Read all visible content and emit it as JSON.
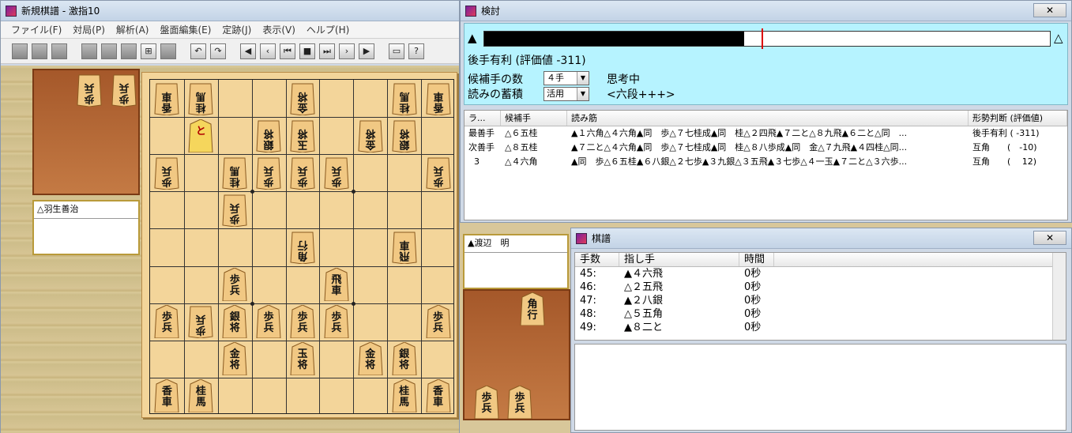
{
  "main_window": {
    "title": "新規棋譜 - 激指10",
    "menu": [
      "ファイル(F)",
      "対局(P)",
      "解析(A)",
      "盤面編集(E)",
      "定跡(J)",
      "表示(V)",
      "ヘルプ(H)"
    ]
  },
  "players": {
    "gote": "△羽生善治",
    "sente": "▲渡辺　明"
  },
  "board": {
    "pieces": [
      {
        "col": 0,
        "row": 0,
        "label": "香\n車",
        "side": "gote"
      },
      {
        "col": 1,
        "row": 0,
        "label": "桂\n馬",
        "side": "gote"
      },
      {
        "col": 4,
        "row": 0,
        "label": "金\n将",
        "side": "gote"
      },
      {
        "col": 7,
        "row": 0,
        "label": "桂\n馬",
        "side": "gote"
      },
      {
        "col": 8,
        "row": 0,
        "label": "香\n車",
        "side": "gote"
      },
      {
        "col": 1,
        "row": 1,
        "label": "と",
        "side": "sente",
        "promoted": true
      },
      {
        "col": 3,
        "row": 1,
        "label": "銀\n将",
        "side": "gote"
      },
      {
        "col": 4,
        "row": 1,
        "label": "玉\n将",
        "side": "gote"
      },
      {
        "col": 6,
        "row": 1,
        "label": "金\n将",
        "side": "gote"
      },
      {
        "col": 7,
        "row": 1,
        "label": "銀\n将",
        "side": "gote"
      },
      {
        "col": 0,
        "row": 2,
        "label": "歩\n兵",
        "side": "gote"
      },
      {
        "col": 2,
        "row": 2,
        "label": "桂\n馬",
        "side": "gote"
      },
      {
        "col": 3,
        "row": 2,
        "label": "歩\n兵",
        "side": "gote"
      },
      {
        "col": 4,
        "row": 2,
        "label": "歩\n兵",
        "side": "gote"
      },
      {
        "col": 5,
        "row": 2,
        "label": "歩\n兵",
        "side": "gote"
      },
      {
        "col": 8,
        "row": 2,
        "label": "歩\n兵",
        "side": "gote"
      },
      {
        "col": 2,
        "row": 3,
        "label": "歩\n兵",
        "side": "gote"
      },
      {
        "col": 4,
        "row": 4,
        "label": "角\n行",
        "side": "gote"
      },
      {
        "col": 7,
        "row": 4,
        "label": "飛\n車",
        "side": "gote"
      },
      {
        "col": 2,
        "row": 5,
        "label": "歩\n兵",
        "side": "sente"
      },
      {
        "col": 5,
        "row": 5,
        "label": "飛\n車",
        "side": "sente"
      },
      {
        "col": 0,
        "row": 6,
        "label": "歩\n兵",
        "side": "sente"
      },
      {
        "col": 1,
        "row": 6,
        "label": "歩\n兵",
        "side": "gote"
      },
      {
        "col": 2,
        "row": 6,
        "label": "銀\n将",
        "side": "sente"
      },
      {
        "col": 3,
        "row": 6,
        "label": "歩\n兵",
        "side": "sente"
      },
      {
        "col": 4,
        "row": 6,
        "label": "歩\n兵",
        "side": "sente"
      },
      {
        "col": 5,
        "row": 6,
        "label": "歩\n兵",
        "side": "sente"
      },
      {
        "col": 8,
        "row": 6,
        "label": "歩\n兵",
        "side": "sente"
      },
      {
        "col": 2,
        "row": 7,
        "label": "金\n将",
        "side": "sente"
      },
      {
        "col": 4,
        "row": 7,
        "label": "玉\n将",
        "side": "sente"
      },
      {
        "col": 6,
        "row": 7,
        "label": "金\n将",
        "side": "sente"
      },
      {
        "col": 7,
        "row": 7,
        "label": "銀\n将",
        "side": "sente"
      },
      {
        "col": 0,
        "row": 8,
        "label": "香\n車",
        "side": "sente"
      },
      {
        "col": 1,
        "row": 8,
        "label": "桂\n馬",
        "side": "sente"
      },
      {
        "col": 7,
        "row": 8,
        "label": "桂\n馬",
        "side": "sente"
      },
      {
        "col": 8,
        "row": 8,
        "label": "香\n車",
        "side": "sente"
      }
    ],
    "gote_hand": [
      "歩\n兵",
      "歩\n兵"
    ],
    "sente_hand": [
      "角\n行",
      "歩\n兵",
      "歩\n兵"
    ]
  },
  "analysis": {
    "title": "検討",
    "close": "✕",
    "sente_symbol": "▲",
    "gote_symbol": "△",
    "eval_fraction": 0.46,
    "eval_text": "後手有利 (評価値 -311)",
    "candidates_label": "候補手の数",
    "candidates_value": "４手",
    "thinking": "思考中",
    "accumulate_label": "読みの蓄積",
    "accumulate_value": "活用",
    "level": "<六段+++>",
    "columns": [
      "ラ...",
      "候補手",
      "読み筋",
      "形勢判断 (評価値)"
    ],
    "rows": [
      {
        "rank": "最善手",
        "move": "△６五桂",
        "line": "▲１六角△４六角▲同　歩△７七桂成▲同　桂△２四飛▲７二と△８九飛▲６二と△同　...",
        "eval": "後手有利 ( -311)"
      },
      {
        "rank": "次善手",
        "move": "△８五桂",
        "line": "▲７二と△４六角▲同　歩△７七桂成▲同　桂△８八歩成▲同　金△７九飛▲４四桂△同...",
        "eval": "互角　　(　-10)"
      },
      {
        "rank": "3",
        "move": "△４六角",
        "line": "▲同　歩△６五桂▲６八銀△２七歩▲３九銀△３五飛▲３七歩△４一玉▲７二と△３六歩...",
        "eval": "互角　　(　 12)"
      }
    ]
  },
  "kifu": {
    "title": "棋譜",
    "close": "✕",
    "columns": [
      "手数",
      "指し手",
      "時間"
    ],
    "rows": [
      {
        "num": "45:",
        "move": "▲４六飛",
        "time": "0秒"
      },
      {
        "num": "46:",
        "move": "△２五飛",
        "time": "0秒"
      },
      {
        "num": "47:",
        "move": "▲２八銀",
        "time": "0秒"
      },
      {
        "num": "48:",
        "move": "△５五角",
        "time": "0秒"
      },
      {
        "num": "49:",
        "move": "▲８二と",
        "time": "0秒"
      }
    ]
  }
}
